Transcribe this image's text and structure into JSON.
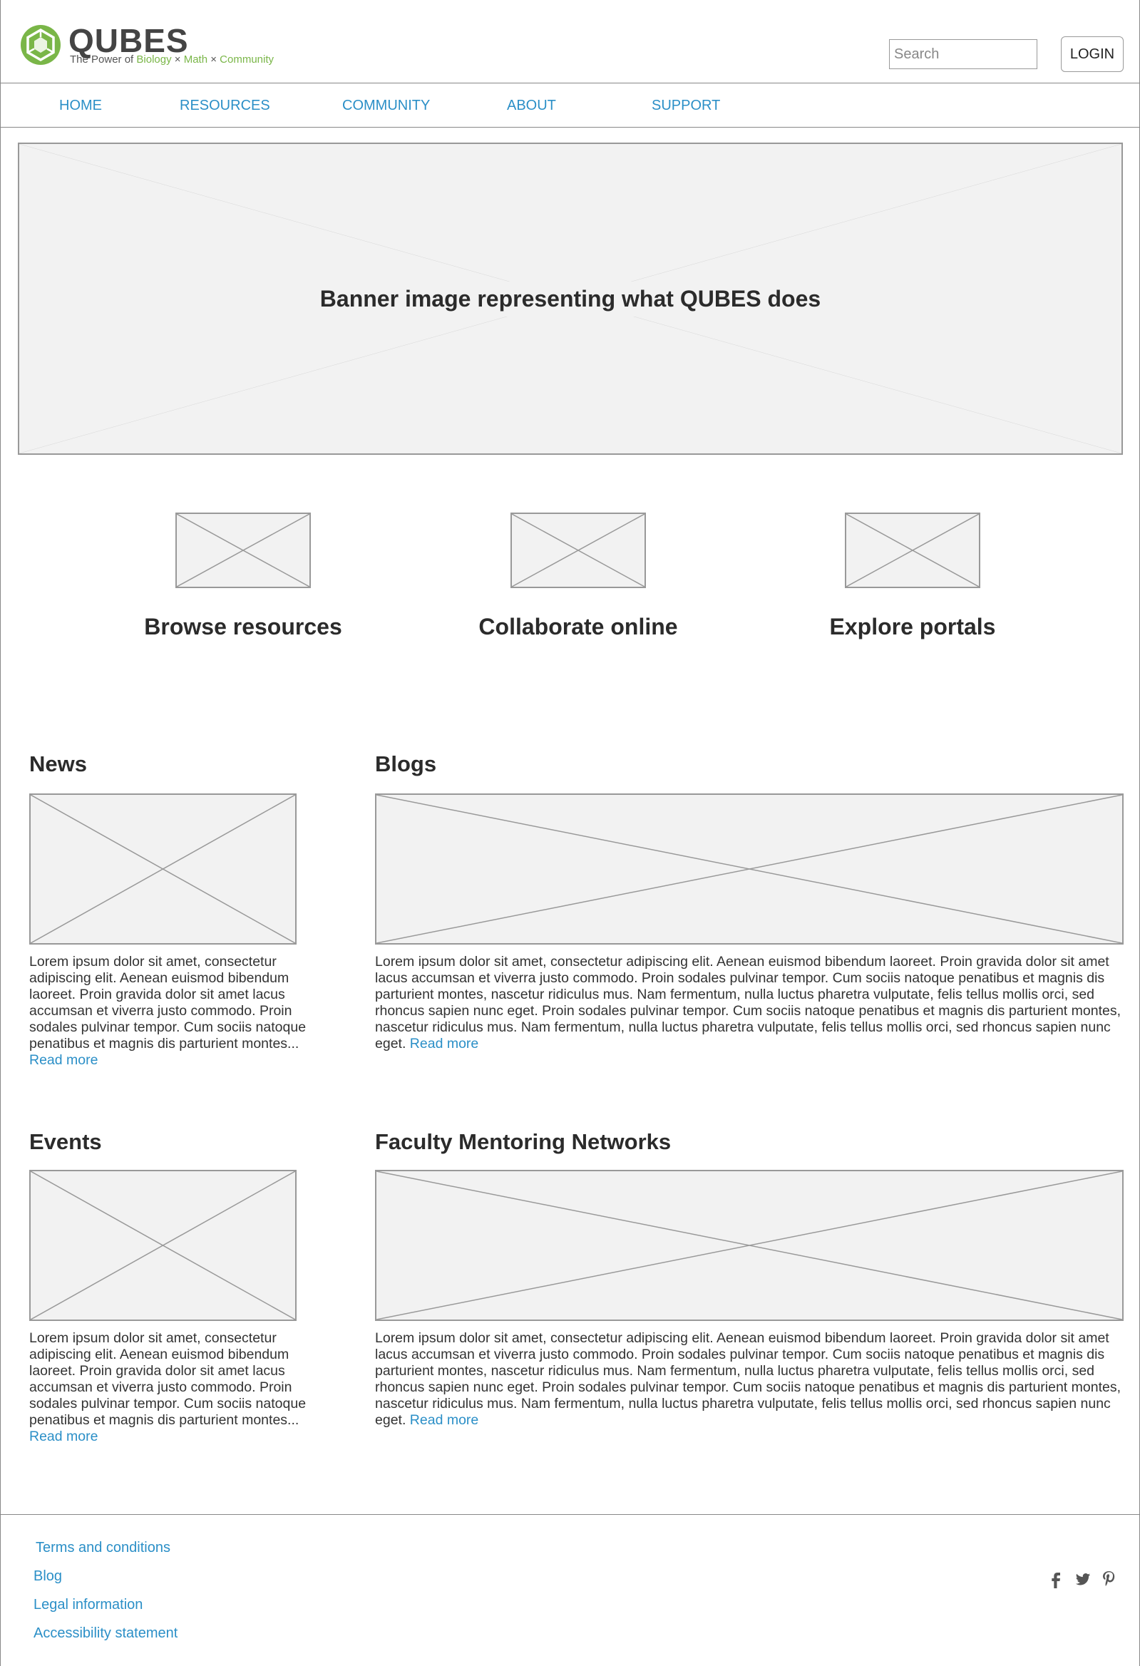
{
  "header": {
    "logo_word": "QUBES",
    "logo_tag_prefix": "The Power of ",
    "logo_tag_biology": "Biology",
    "logo_tag_x1": " × ",
    "logo_tag_math": "Math",
    "logo_tag_x2": " × ",
    "logo_tag_community": "Community",
    "search_placeholder": "Search",
    "login_label": "LOGIN"
  },
  "nav": {
    "items": [
      {
        "label": "HOME"
      },
      {
        "label": "RESOURCES"
      },
      {
        "label": "COMMUNITY"
      },
      {
        "label": "ABOUT"
      },
      {
        "label": "SUPPORT"
      }
    ]
  },
  "banner": {
    "text": "Banner image representing what QUBES does"
  },
  "features": [
    {
      "title": "Browse resources"
    },
    {
      "title": "Collaborate online"
    },
    {
      "title": "Explore portals"
    }
  ],
  "sections": {
    "news": {
      "title": "News",
      "body": "Lorem ipsum dolor sit amet, consectetur adipiscing elit. Aenean euismod bibendum laoreet. Proin gravida dolor sit amet lacus accumsan et viverra justo commodo. Proin sodales pulvinar tempor. Cum sociis natoque penatibus et magnis dis parturient montes... ",
      "link": "Read more"
    },
    "blogs": {
      "title": "Blogs",
      "body": "Lorem ipsum dolor sit amet, consectetur adipiscing elit. Aenean euismod bibendum laoreet. Proin gravida dolor sit amet lacus accumsan et viverra justo commodo. Proin sodales pulvinar tempor. Cum sociis natoque penatibus et magnis dis parturient montes, nascetur ridiculus mus. Nam fermentum, nulla luctus pharetra vulputate, felis tellus mollis orci, sed rhoncus sapien nunc eget. Proin sodales pulvinar tempor. Cum sociis natoque penatibus et magnis dis parturient montes, nascetur ridiculus mus. Nam fermentum, nulla luctus pharetra vulputate, felis tellus mollis orci, sed rhoncus sapien nunc eget. ",
      "link": "Read more"
    },
    "events": {
      "title": "Events",
      "body": "Lorem ipsum dolor sit amet, consectetur adipiscing elit. Aenean euismod bibendum laoreet. Proin gravida dolor sit amet lacus accumsan et viverra justo commodo. Proin sodales pulvinar tempor. Cum sociis natoque penatibus et magnis dis parturient montes... ",
      "link": "Read more"
    },
    "fmn": {
      "title": "Faculty Mentoring Networks",
      "body": "Lorem ipsum dolor sit amet, consectetur adipiscing elit. Aenean euismod bibendum laoreet. Proin gravida dolor sit amet lacus accumsan et viverra justo commodo. Proin sodales pulvinar tempor. Cum sociis natoque penatibus et magnis dis parturient montes, nascetur ridiculus mus. Nam fermentum, nulla luctus pharetra vulputate, felis tellus mollis orci, sed rhoncus sapien nunc eget. Proin sodales pulvinar tempor. Cum sociis natoque penatibus et magnis dis parturient montes, nascetur ridiculus mus. Nam fermentum, nulla luctus pharetra vulputate, felis tellus mollis orci, sed rhoncus sapien nunc eget. ",
      "link": "Read more"
    }
  },
  "footer": {
    "links": [
      {
        "label": "Terms and conditions"
      },
      {
        "label": "Blog"
      },
      {
        "label": "Legal information"
      },
      {
        "label": "Accessibility statement"
      }
    ],
    "social": [
      "facebook-icon",
      "twitter-icon",
      "pinterest-icon"
    ]
  },
  "colors": {
    "link": "#2b8fc7",
    "brand_green": "#7ab648",
    "placeholder_fill": "#f2f2f2",
    "placeholder_stroke": "#999999"
  }
}
